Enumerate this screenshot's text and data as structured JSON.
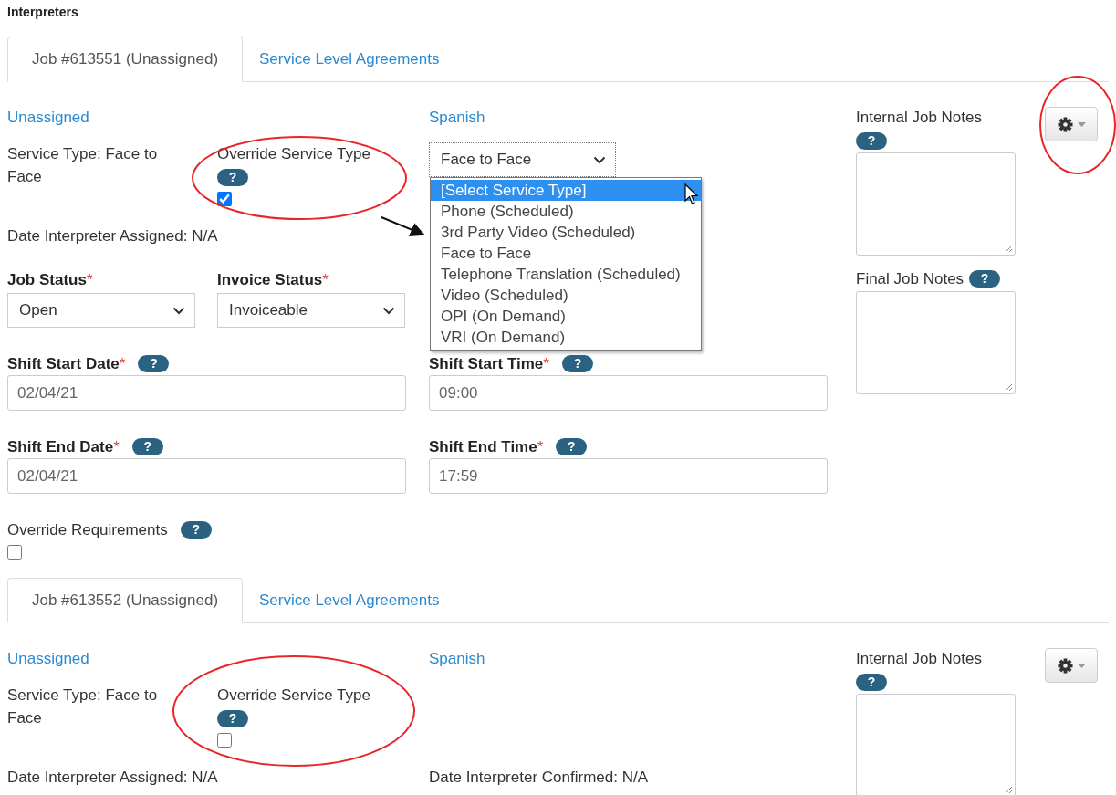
{
  "page_title": "Interpreters",
  "jobs": [
    {
      "tabs": [
        {
          "label": "Job #613551 (Unassigned)",
          "selected": true
        },
        {
          "label": "Service Level Agreements",
          "selected": false
        }
      ],
      "interpreter_link": "Unassigned",
      "language_link": "Spanish",
      "service_type": "Service Type: Face to Face",
      "override_service_type": {
        "label": "Override Service Type",
        "help": "?",
        "checked": true
      },
      "service_type_select": {
        "value": "Face to Face",
        "expanded": true,
        "options": [
          {
            "label": "[Select Service Type]",
            "highlighted": true
          },
          {
            "label": "Phone (Scheduled)",
            "highlighted": false
          },
          {
            "label": "3rd Party Video (Scheduled)",
            "highlighted": false
          },
          {
            "label": "Face to Face",
            "highlighted": false
          },
          {
            "label": "Telephone Translation (Scheduled)",
            "highlighted": false
          },
          {
            "label": "Video (Scheduled)",
            "highlighted": false
          },
          {
            "label": "OPI (On Demand)",
            "highlighted": false
          },
          {
            "label": "VRI (On Demand)",
            "highlighted": false
          }
        ]
      },
      "date_assigned": "Date Interpreter Assigned: N/A",
      "status_fields": [
        {
          "label": "Job Status",
          "required_mark": "*",
          "value": "Open"
        },
        {
          "label": "Invoice Status",
          "required_mark": "*",
          "value": "Invoiceable"
        }
      ],
      "date_rows": [
        [
          {
            "label": "Shift Start Date",
            "required_mark": "*",
            "help": "?",
            "value": "02/04/21"
          },
          {
            "label": "Shift Start Time",
            "required_mark": "*",
            "help": "?",
            "value": "09:00"
          }
        ],
        [
          {
            "label": "Shift End Date",
            "required_mark": "*",
            "help": "?",
            "value": "02/04/21"
          },
          {
            "label": "Shift End Time",
            "required_mark": "*",
            "help": "?",
            "value": "17:59"
          }
        ]
      ],
      "override_requirements": {
        "label": "Override Requirements",
        "help": "?",
        "checked": false
      },
      "internal_notes": {
        "label": "Internal Job Notes",
        "help": "?"
      },
      "final_notes": {
        "label": "Final Job Notes",
        "help": "?"
      }
    },
    {
      "tabs": [
        {
          "label": "Job #613552 (Unassigned)",
          "selected": true
        },
        {
          "label": "Service Level Agreements",
          "selected": false
        }
      ],
      "interpreter_link": "Unassigned",
      "language_link": "Spanish",
      "service_type": "Service Type: Face to Face",
      "override_service_type": {
        "label": "Override Service Type",
        "help": "?",
        "checked": false
      },
      "date_assigned": "Date Interpreter Assigned: N/A",
      "date_confirmed": "Date Interpreter Confirmed: N/A",
      "internal_notes": {
        "label": "Internal Job Notes",
        "help": "?"
      }
    }
  ]
}
